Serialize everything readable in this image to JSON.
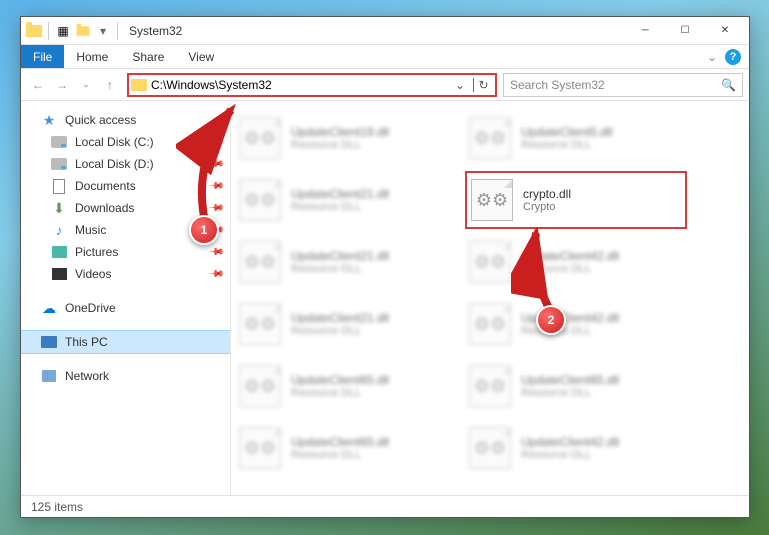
{
  "window_title": "System32",
  "tabs": {
    "file": "File",
    "home": "Home",
    "share": "Share",
    "view": "View"
  },
  "address_path": "C:\\Windows\\System32",
  "search_placeholder": "Search System32",
  "sidebar": {
    "quick_access": "Quick access",
    "items": [
      {
        "label": "Local Disk (C:)"
      },
      {
        "label": "Local Disk (D:)"
      },
      {
        "label": "Documents"
      },
      {
        "label": "Downloads"
      },
      {
        "label": "Music"
      },
      {
        "label": "Pictures"
      },
      {
        "label": "Videos"
      }
    ],
    "onedrive": "OneDrive",
    "this_pc": "This PC",
    "network": "Network"
  },
  "files": [
    {
      "name": "UpdateClient19.dll",
      "desc": "Resource DLL"
    },
    {
      "name": "UpdateClient5.dll",
      "desc": "Resource DLL"
    },
    {
      "name": "UpdateClient21.dll",
      "desc": "Resource DLL"
    },
    {
      "name": "crypto.dll",
      "desc": "Crypto"
    },
    {
      "name": "UpdateClient21.dll",
      "desc": "Resource DLL"
    },
    {
      "name": "UpdateClient42.dll",
      "desc": "Resource DLL"
    },
    {
      "name": "UpdateClient21.dll",
      "desc": "Resource DLL"
    },
    {
      "name": "UpdateClient42.dll",
      "desc": "Resource DLL"
    },
    {
      "name": "UpdateClient65.dll",
      "desc": "Resource DLL"
    },
    {
      "name": "UpdateClient65.dll",
      "desc": "Resource DLL"
    },
    {
      "name": "UpdateClient65.dll",
      "desc": "Resource DLL"
    },
    {
      "name": "UpdateClient42.dll",
      "desc": "Resource DLL"
    }
  ],
  "status": "125 items",
  "callouts": {
    "one": "1",
    "two": "2"
  }
}
